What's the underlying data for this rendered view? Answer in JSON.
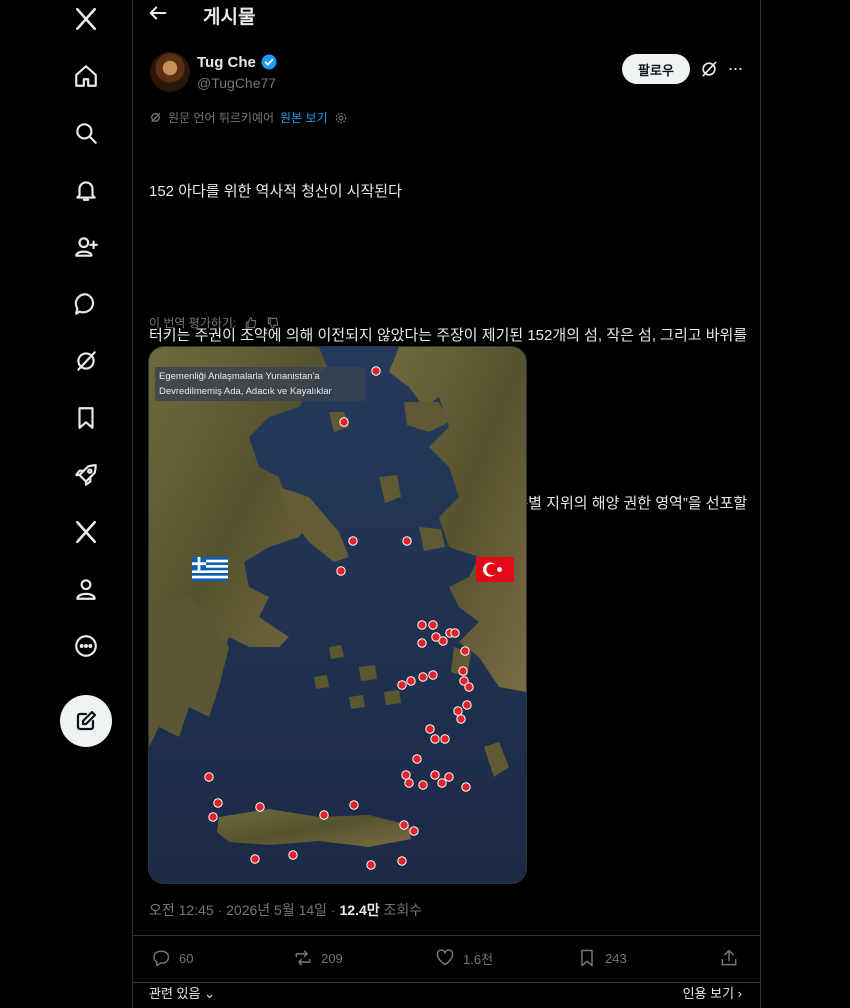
{
  "header": {
    "title": "게시물"
  },
  "author": {
    "name": "Tug Che",
    "handle": "@TugChe77"
  },
  "follow_label": "팔로우",
  "translation": {
    "text": "원문 언어 튀르키예어",
    "link": "원본 보기"
  },
  "tweet": {
    "line1": "152 아다를 위한 역사적 청산이 시작된다",
    "para2": "터키는 주권이 조약에 의해 이전되지 않았다는 주장이 제기된 152개의 섬, 작은 섬, 그리고 바위를 터키 영토로 선포할 준비를 하고 있다.",
    "para3": "대통령에게는 또한 경제 구역으로 선포되지 않은 지역에서 “특별 지위의 해양 권한 영역”을 선포할 권한이 부여될 것이라고 알려졌다."
  },
  "rate_label": "이 번역 평가하기:",
  "media": {
    "caption_line1": "Egemenliği Anlaşmalarla Yunanistan'a",
    "caption_line2": "Devredilmemiş Ada, Adacık ve Kayalıklar"
  },
  "meta": {
    "time": "오전 12:45 · 2026년 5월 14일 · ",
    "views_value": "12.4만",
    "views_label": " 조회수"
  },
  "actions": {
    "replies": "60",
    "reposts": "209",
    "likes": "1.6천",
    "bookmarks": "243"
  },
  "footer": {
    "related": "관련 있음",
    "quotes": "인용 보기"
  },
  "colors": {
    "accent": "#1d9bf0",
    "marker": "#e0242b",
    "background": "#000000"
  },
  "icons": [
    "x-logo-icon",
    "home-icon",
    "search-icon",
    "bell-icon",
    "people-icon",
    "message-icon",
    "grok-icon",
    "bookmark-icon",
    "rocket-icon",
    "x-premium-icon",
    "profile-icon",
    "more-circle-icon",
    "compose-icon"
  ]
}
